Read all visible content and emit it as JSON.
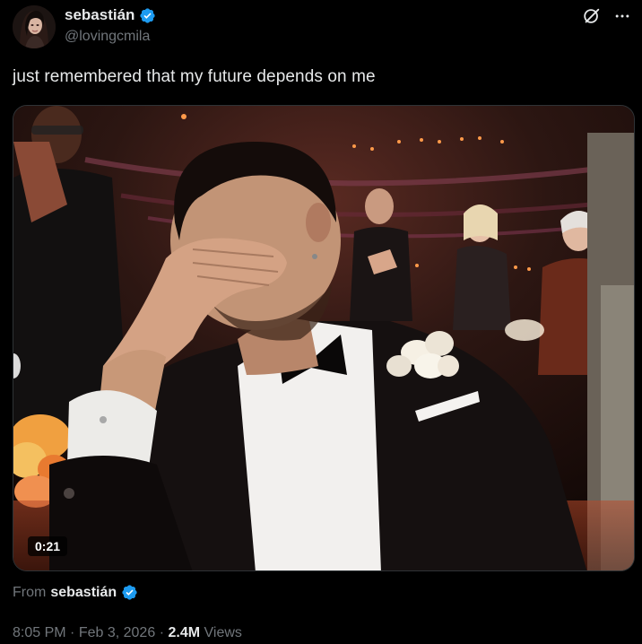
{
  "author": {
    "display_name": "sebastián",
    "handle": "@lovingcmila",
    "avatar_icon": "profile-avatar",
    "verified_icon": "verified-badge-icon"
  },
  "actions": {
    "grok_icon": "grok-icon",
    "more_icon": "more-icon"
  },
  "tweet": {
    "text": "just remembered that my future depends on me"
  },
  "media": {
    "type": "video",
    "duration": "0:21"
  },
  "from": {
    "label": "From",
    "name": "sebastián"
  },
  "meta": {
    "time": "8:05 PM",
    "separator1": "·",
    "date": "Feb 3, 2026",
    "separator2": "·",
    "views_count": "2.4M",
    "views_label": "Views"
  },
  "colors": {
    "background": "#000000",
    "text_primary": "#e7e9ea",
    "text_secondary": "#71767b",
    "verified_blue": "#1d9bf0",
    "border": "#2f3336"
  }
}
